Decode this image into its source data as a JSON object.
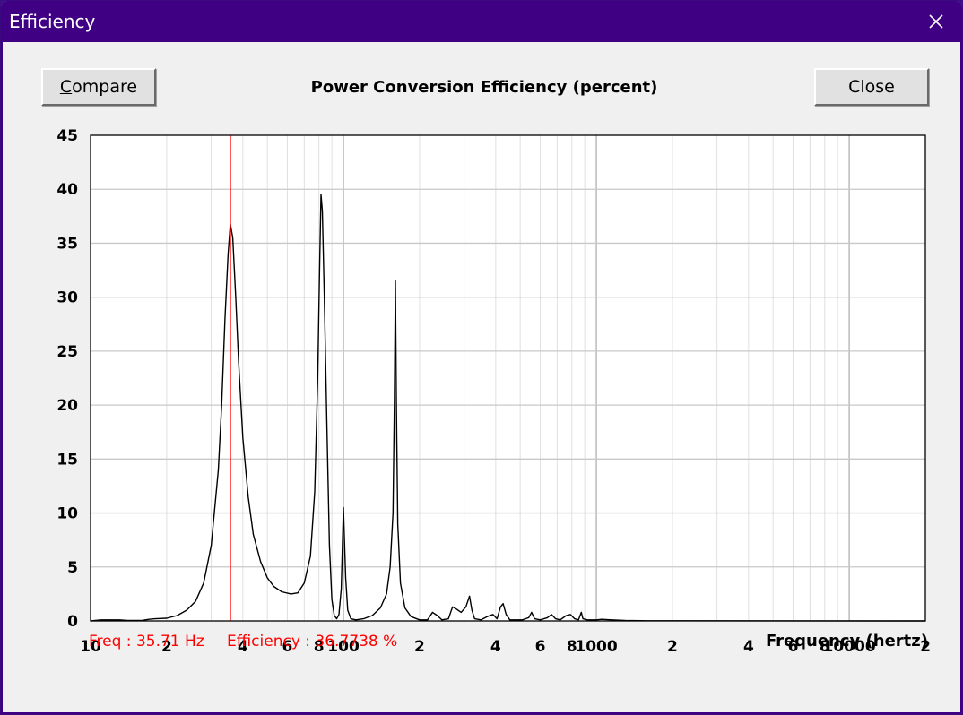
{
  "window": {
    "title": "Efficiency",
    "close_icon": "close-icon",
    "title_bar_color": "#3f0084"
  },
  "toolbar": {
    "compare_label": "Compare",
    "compare_mnemonic": "C",
    "close_label": "Close"
  },
  "readout": {
    "freq_text": "Freq : 35.71 Hz",
    "efficiency_text": "Efficiency : 36.7738 %",
    "color": "#ff0000"
  },
  "chart_data": {
    "type": "line",
    "title": "Power Conversion Efficiency (percent)",
    "xlabel": "Frequency (hertz)",
    "ylabel": "",
    "x_scale": "log",
    "xlim": [
      10,
      20000
    ],
    "ylim": [
      0,
      45
    ],
    "grid": true,
    "y_ticks": [
      0,
      5,
      10,
      15,
      20,
      25,
      30,
      35,
      40,
      45
    ],
    "y_tick_labels": [
      "0",
      "5",
      "10",
      "15",
      "20",
      "25",
      "30",
      "35",
      "40",
      "45"
    ],
    "x_ticks": [
      10,
      20,
      40,
      60,
      80,
      100,
      200,
      400,
      600,
      800,
      1000,
      2000,
      4000,
      6000,
      8000,
      10000,
      20000
    ],
    "x_tick_labels": [
      "10",
      "2",
      "4",
      "6",
      "8",
      "100",
      "2",
      "4",
      "6",
      "8",
      "1000",
      "2",
      "4",
      "6",
      "8",
      "10000",
      "2"
    ],
    "cursor": {
      "x": 35.71,
      "color": "#ff0000"
    },
    "line_color": "#000000",
    "series": [
      {
        "values": [
          [
            10,
            0
          ],
          [
            11,
            0.1
          ],
          [
            12,
            0.1
          ],
          [
            13,
            0.1
          ],
          [
            14,
            0.05
          ],
          [
            16,
            0.05
          ],
          [
            17,
            0.15
          ],
          [
            18,
            0.2
          ],
          [
            20,
            0.25
          ],
          [
            22,
            0.5
          ],
          [
            24,
            1.0
          ],
          [
            26,
            1.8
          ],
          [
            28,
            3.5
          ],
          [
            30,
            7.0
          ],
          [
            32,
            14.0
          ],
          [
            33,
            20.0
          ],
          [
            34,
            28.0
          ],
          [
            35,
            34.0
          ],
          [
            35.71,
            36.77
          ],
          [
            36.5,
            35.5
          ],
          [
            37.5,
            30.0
          ],
          [
            38.5,
            24.0
          ],
          [
            40,
            17.0
          ],
          [
            42,
            11.5
          ],
          [
            44,
            8.0
          ],
          [
            47,
            5.5
          ],
          [
            50,
            4.0
          ],
          [
            53,
            3.2
          ],
          [
            57,
            2.7
          ],
          [
            62,
            2.5
          ],
          [
            66,
            2.6
          ],
          [
            70,
            3.5
          ],
          [
            74,
            6.0
          ],
          [
            77,
            12.0
          ],
          [
            79,
            22.0
          ],
          [
            80.5,
            33.0
          ],
          [
            81.5,
            39.5
          ],
          [
            82.5,
            38.0
          ],
          [
            84,
            30.0
          ],
          [
            86,
            18.0
          ],
          [
            88,
            7.0
          ],
          [
            90,
            2.0
          ],
          [
            92,
            0.5
          ],
          [
            94,
            0.2
          ],
          [
            96,
            0.6
          ],
          [
            98,
            3.0
          ],
          [
            100,
            10.5
          ],
          [
            102,
            4.0
          ],
          [
            104,
            1.0
          ],
          [
            107,
            0.2
          ],
          [
            112,
            0.1
          ],
          [
            120,
            0.2
          ],
          [
            130,
            0.5
          ],
          [
            140,
            1.2
          ],
          [
            148,
            2.5
          ],
          [
            153,
            5.0
          ],
          [
            157,
            10.0
          ],
          [
            159,
            20.0
          ],
          [
            160.5,
            31.5
          ],
          [
            162,
            20.0
          ],
          [
            164,
            9.0
          ],
          [
            168,
            3.5
          ],
          [
            175,
            1.2
          ],
          [
            185,
            0.4
          ],
          [
            200,
            0.1
          ],
          [
            215,
            0.1
          ],
          [
            225,
            0.8
          ],
          [
            235,
            0.5
          ],
          [
            245,
            0.1
          ],
          [
            260,
            0.2
          ],
          [
            270,
            1.3
          ],
          [
            280,
            1.1
          ],
          [
            292,
            0.8
          ],
          [
            305,
            1.3
          ],
          [
            315,
            2.3
          ],
          [
            322,
            1.0
          ],
          [
            330,
            0.2
          ],
          [
            350,
            0.1
          ],
          [
            370,
            0.4
          ],
          [
            390,
            0.6
          ],
          [
            405,
            0.2
          ],
          [
            418,
            1.3
          ],
          [
            428,
            1.6
          ],
          [
            440,
            0.6
          ],
          [
            455,
            0.1
          ],
          [
            480,
            0.1
          ],
          [
            510,
            0.1
          ],
          [
            540,
            0.3
          ],
          [
            555,
            0.8
          ],
          [
            570,
            0.2
          ],
          [
            600,
            0.1
          ],
          [
            640,
            0.3
          ],
          [
            665,
            0.6
          ],
          [
            690,
            0.2
          ],
          [
            720,
            0.1
          ],
          [
            760,
            0.5
          ],
          [
            790,
            0.6
          ],
          [
            820,
            0.2
          ],
          [
            850,
            0.1
          ],
          [
            872,
            0.8
          ],
          [
            885,
            0.2
          ],
          [
            920,
            0.1
          ],
          [
            1000,
            0.1
          ],
          [
            1050,
            0.15
          ],
          [
            1150,
            0.1
          ],
          [
            1300,
            0.05
          ],
          [
            1600,
            0.02
          ],
          [
            20000,
            0
          ]
        ]
      }
    ]
  }
}
